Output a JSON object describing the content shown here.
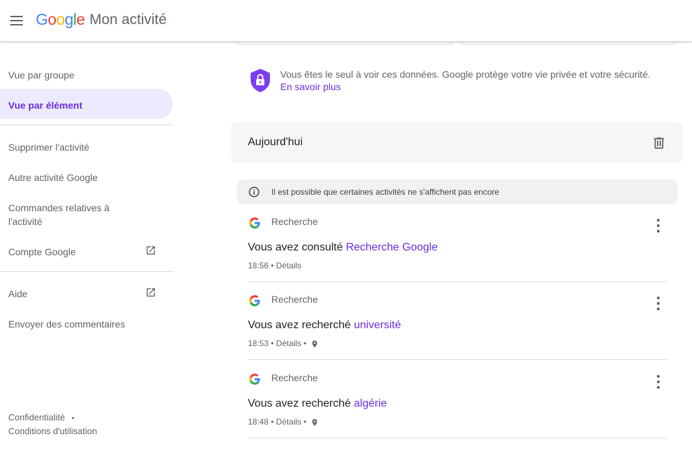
{
  "header": {
    "logo_letters": [
      "G",
      "o",
      "o",
      "g",
      "l",
      "e"
    ],
    "product": "Mon activité"
  },
  "sidebar": {
    "items": [
      {
        "label": "Vue par groupe"
      },
      {
        "label": "Vue par élément"
      },
      {
        "label": "Supprimer l'activité"
      },
      {
        "label": "Autre activité Google"
      },
      {
        "label": "Commandes relatives à l'activité"
      },
      {
        "label": "Compte Google"
      },
      {
        "label": "Aide"
      },
      {
        "label": "Envoyer des commentaires"
      }
    ],
    "footer": {
      "privacy": "Confidentialité",
      "separator": "•",
      "terms": "Conditions d'utilisation"
    }
  },
  "privacy_notice": {
    "text": "Vous êtes le seul à voir ces données. Google protège votre vie privée et votre sécurité.",
    "link": "En savoir plus"
  },
  "day": {
    "title": "Aujourd'hui"
  },
  "notice": {
    "text": "Il est possible que certaines activités ne s'affichent pas encore"
  },
  "entries": [
    {
      "product": "Recherche",
      "prefix": "Vous avez consulté ",
      "link": "Recherche Google",
      "time": "18:56",
      "details": "Détails",
      "has_location": false
    },
    {
      "product": "Recherche",
      "prefix": "Vous avez recherché ",
      "link": "université",
      "time": "18:53",
      "details": "Détails",
      "has_location": true
    },
    {
      "product": "Recherche",
      "prefix": "Vous avez recherché ",
      "link": "algérie",
      "time": "18:48",
      "details": "Détails",
      "has_location": true
    }
  ],
  "colors": {
    "accent": "#6a2de0",
    "active_bg": "#ecebfd"
  }
}
